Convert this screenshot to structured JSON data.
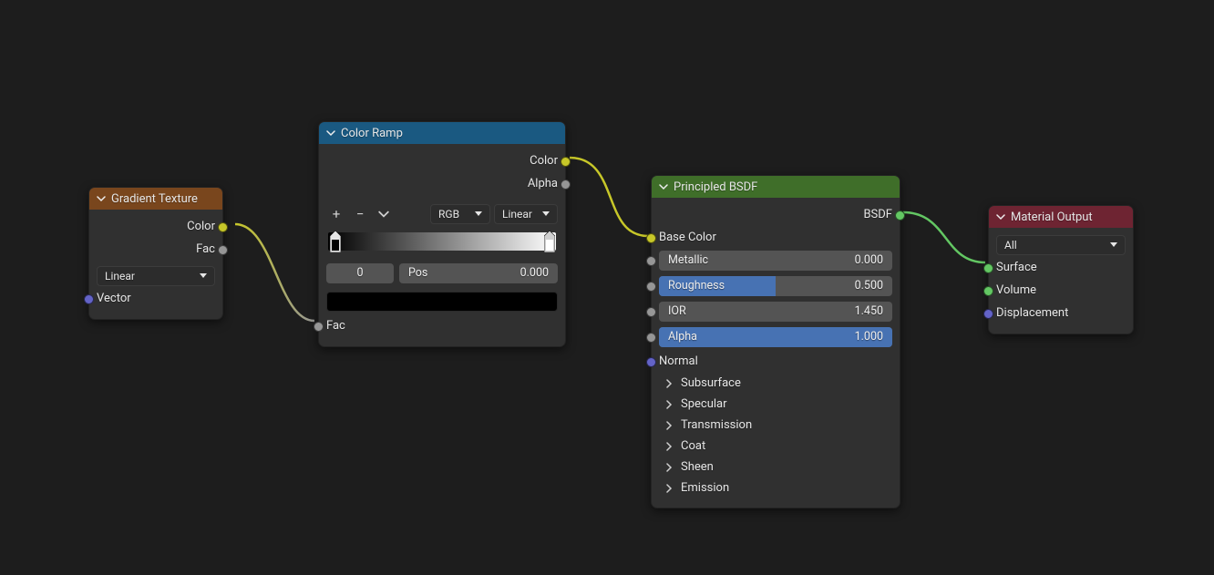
{
  "nodes": {
    "gradient": {
      "title": "Gradient Texture",
      "outputs": {
        "color": "Color",
        "fac": "Fac"
      },
      "type_select": "Linear",
      "inputs": {
        "vector": "Vector"
      }
    },
    "ramp": {
      "title": "Color Ramp",
      "outputs": {
        "color": "Color",
        "alpha": "Alpha"
      },
      "add_icon": "+",
      "remove_icon": "−",
      "mode_select": "RGB",
      "interp_select": "Linear",
      "stop_index": "0",
      "pos_label": "Pos",
      "pos_value": "0.000",
      "inputs": {
        "fac": "Fac"
      }
    },
    "bsdf": {
      "title": "Principled BSDF",
      "outputs": {
        "bsdf": "BSDF"
      },
      "inputs": {
        "base_color": "Base Color",
        "metallic_label": "Metallic",
        "metallic_value": "0.000",
        "roughness_label": "Roughness",
        "roughness_value": "0.500",
        "ior_label": "IOR",
        "ior_value": "1.450",
        "alpha_label": "Alpha",
        "alpha_value": "1.000",
        "normal": "Normal"
      },
      "panels": {
        "subsurface": "Subsurface",
        "specular": "Specular",
        "transmission": "Transmission",
        "coat": "Coat",
        "sheen": "Sheen",
        "emission": "Emission"
      }
    },
    "output": {
      "title": "Material Output",
      "target_select": "All",
      "inputs": {
        "surface": "Surface",
        "volume": "Volume",
        "displacement": "Displacement"
      }
    }
  }
}
